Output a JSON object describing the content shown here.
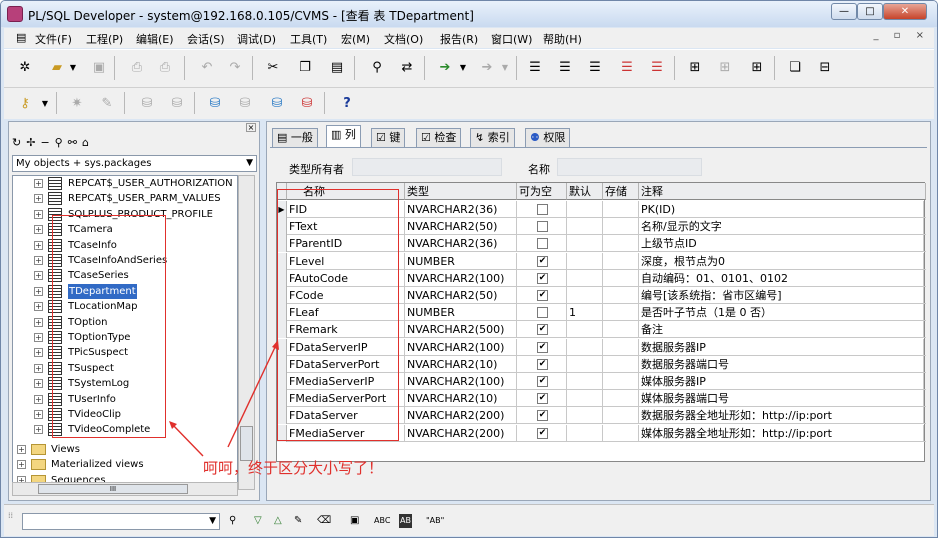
{
  "window": {
    "title": "PL/SQL Developer - system@192.168.0.105/CVMS - [查看 表 TDepartment]",
    "controls": {
      "minimize": "—",
      "maximize": "□",
      "close": "✕"
    }
  },
  "menu": [
    "文件(F)",
    "工程(P)",
    "编辑(E)",
    "会话(S)",
    "调试(D)",
    "工具(T)",
    "宏(M)",
    "文档(O)",
    "报告(R)",
    "窗口(W)",
    "帮助(H)"
  ],
  "mdi_controls": "_ ▫ ×",
  "toolbar1": [
    "new-icon",
    "open-icon",
    "save-icon",
    "print-icon",
    "print-preview-icon",
    "undo-icon",
    "redo-icon",
    "cut-icon",
    "copy-icon",
    "paste-icon",
    "find-icon",
    "replace-icon",
    "execute-icon",
    "run-icon",
    "indent-icon",
    "outdent-icon",
    "comment-icon",
    "uncomment-icon",
    "tree-icon",
    "window-icon"
  ],
  "toolbar2": [
    "key-icon",
    "compile-icon",
    "pen-icon",
    "db-icon",
    "db2-icon",
    "user-icon",
    "schema-icon",
    "grant-icon",
    "revoke-icon",
    "help-icon"
  ],
  "left_panel": {
    "object_selector": "My objects + sys.packages",
    "tree": [
      {
        "label": "REPCAT$_USER_AUTHORIZATION",
        "type": "table"
      },
      {
        "label": "REPCAT$_USER_PARM_VALUES",
        "type": "table"
      },
      {
        "label": "SQLPLUS_PRODUCT_PROFILE",
        "type": "table"
      },
      {
        "label": "TCamera",
        "type": "table"
      },
      {
        "label": "TCaseInfo",
        "type": "table"
      },
      {
        "label": "TCaseInfoAndSeries",
        "type": "table"
      },
      {
        "label": "TCaseSeries",
        "type": "table"
      },
      {
        "label": "TDepartment",
        "type": "table",
        "selected": true
      },
      {
        "label": "TLocationMap",
        "type": "table"
      },
      {
        "label": "TOption",
        "type": "table"
      },
      {
        "label": "TOptionType",
        "type": "table"
      },
      {
        "label": "TPicSuspect",
        "type": "table"
      },
      {
        "label": "TSuspect",
        "type": "table"
      },
      {
        "label": "TSystemLog",
        "type": "table"
      },
      {
        "label": "TUserInfo",
        "type": "table"
      },
      {
        "label": "TVideoClip",
        "type": "table"
      },
      {
        "label": "TVideoComplete",
        "type": "table"
      },
      {
        "label": "Views",
        "type": "folder"
      },
      {
        "label": "Materialized views",
        "type": "folder"
      },
      {
        "label": "Sequences",
        "type": "folder"
      }
    ],
    "hscroll_label": "III"
  },
  "annotation": "呵呵，终于区分大小写了！",
  "tabs": [
    {
      "label": "一般",
      "icon": "general-icon"
    },
    {
      "label": "列",
      "icon": "columns-icon",
      "active": true
    },
    {
      "label": "键",
      "icon": "keys-icon"
    },
    {
      "label": "检查",
      "icon": "checks-icon"
    },
    {
      "label": "索引",
      "icon": "indexes-icon"
    },
    {
      "label": "权限",
      "icon": "privileges-icon"
    }
  ],
  "fields": {
    "owner_label": "类型所有者",
    "name_label": "名称"
  },
  "grid": {
    "headers": [
      "名称",
      "类型",
      "可为空",
      "默认",
      "存储",
      "注释"
    ],
    "rows": [
      {
        "name": "FID",
        "type": "NVARCHAR2(36)",
        "nullable": false,
        "default": "",
        "comment": "PK(ID)"
      },
      {
        "name": "FText",
        "type": "NVARCHAR2(50)",
        "nullable": false,
        "default": "",
        "comment": "名称/显示的文字"
      },
      {
        "name": "FParentID",
        "type": "NVARCHAR2(36)",
        "nullable": false,
        "default": "",
        "comment": "上级节点ID"
      },
      {
        "name": "FLevel",
        "type": "NUMBER",
        "nullable": true,
        "default": "",
        "comment": "深度，根节点为0"
      },
      {
        "name": "FAutoCode",
        "type": "NVARCHAR2(100)",
        "nullable": true,
        "default": "",
        "comment": "自动编码：01、0101、0102"
      },
      {
        "name": "FCode",
        "type": "NVARCHAR2(50)",
        "nullable": true,
        "default": "",
        "comment": "编号[该系统指：省市区编号]"
      },
      {
        "name": "FLeaf",
        "type": "NUMBER",
        "nullable": false,
        "default": "1",
        "comment": "是否叶子节点（1是 0 否）"
      },
      {
        "name": "FRemark",
        "type": "NVARCHAR2(500)",
        "nullable": true,
        "default": "",
        "comment": "备注"
      },
      {
        "name": "FDataServerIP",
        "type": "NVARCHAR2(100)",
        "nullable": true,
        "default": "",
        "comment": "数据服务器IP"
      },
      {
        "name": "FDataServerPort",
        "type": "NVARCHAR2(10)",
        "nullable": true,
        "default": "",
        "comment": "数据服务器端口号"
      },
      {
        "name": "FMediaServerIP",
        "type": "NVARCHAR2(100)",
        "nullable": true,
        "default": "",
        "comment": "媒体服务器IP"
      },
      {
        "name": "FMediaServerPort",
        "type": "NVARCHAR2(10)",
        "nullable": true,
        "default": "",
        "comment": "媒体服务器端口号"
      },
      {
        "name": "FDataServer",
        "type": "NVARCHAR2(200)",
        "nullable": true,
        "default": "",
        "comment": "数据服务器全地址形如：http://ip:port"
      },
      {
        "name": "FMediaServer",
        "type": "NVARCHAR2(200)",
        "nullable": true,
        "default": "",
        "comment": "媒体服务器全地址形如：http://ip:port"
      }
    ]
  },
  "statusbar": {
    "abc_label": "ABC",
    "ab_label": "AB",
    "quoted_ab_label": "\"AB\""
  },
  "colors": {
    "annotation_red": "#e0302c",
    "selection_blue": "#316ac5"
  }
}
